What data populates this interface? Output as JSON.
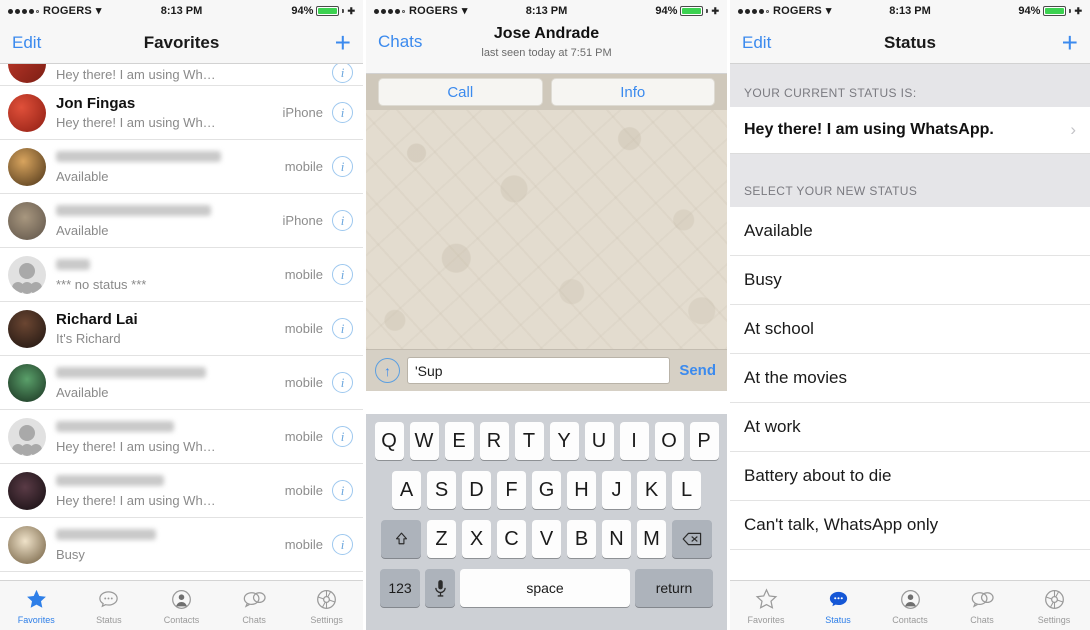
{
  "status_bar": {
    "carrier": "ROGERS",
    "wifi_icon": "wifi-icon",
    "time": "8:13 PM",
    "battery_pct": "94%"
  },
  "panel_favorites": {
    "nav": {
      "left_label": "Edit",
      "title": "Favorites",
      "right_icon": "plus-icon"
    },
    "rows": [
      {
        "name": "",
        "name_blurred": true,
        "sub": "Hey there! I am using Wh…",
        "label": "",
        "avatar": "photo",
        "partial": true
      },
      {
        "name": "Jon Fingas",
        "name_blurred": false,
        "sub": "Hey there! I am using Wh…",
        "label": "iPhone",
        "avatar": "photo"
      },
      {
        "name": "",
        "name_blurred": true,
        "sub": "Available",
        "label": "mobile",
        "avatar": "photo"
      },
      {
        "name": "",
        "name_blurred": true,
        "sub": "Available",
        "label": "iPhone",
        "avatar": "photo"
      },
      {
        "name": "",
        "name_blurred": true,
        "sub": "*** no status ***",
        "label": "mobile",
        "avatar": "placeholder"
      },
      {
        "name": "Richard Lai",
        "name_blurred": false,
        "sub": "It's Richard",
        "label": "mobile",
        "avatar": "photo"
      },
      {
        "name": "",
        "name_blurred": true,
        "sub": "Available",
        "label": "mobile",
        "avatar": "photo"
      },
      {
        "name": "",
        "name_blurred": true,
        "sub": "Hey there! I am using Wh…",
        "label": "mobile",
        "avatar": "placeholder"
      },
      {
        "name": "",
        "name_blurred": true,
        "sub": "Hey there! I am using Wh…",
        "label": "mobile",
        "avatar": "photo"
      },
      {
        "name": "",
        "name_blurred": true,
        "sub": "Busy",
        "label": "mobile",
        "avatar": "photo"
      }
    ]
  },
  "panel_chat": {
    "nav": {
      "back_label": "Chats",
      "title": "Jose Andrade",
      "subtitle": "last seen today at 7:51 PM"
    },
    "actions": [
      "Call",
      "Info"
    ],
    "input": {
      "attach_icon": "attach-up-arrow-icon",
      "value": "'Sup",
      "placeholder": "",
      "send_label": "Send"
    },
    "keyboard": {
      "row1": [
        "Q",
        "W",
        "E",
        "R",
        "T",
        "Y",
        "U",
        "I",
        "O",
        "P"
      ],
      "row2": [
        "A",
        "S",
        "D",
        "F",
        "G",
        "H",
        "J",
        "K",
        "L"
      ],
      "row3": [
        "Z",
        "X",
        "C",
        "V",
        "B",
        "N",
        "M"
      ],
      "shift_icon": "shift-icon",
      "backspace_icon": "backspace-icon",
      "numbers_label": "123",
      "mic_icon": "microphone-icon",
      "space_label": "space",
      "return_label": "return"
    }
  },
  "panel_status": {
    "nav": {
      "left_label": "Edit",
      "title": "Status",
      "right_icon": "plus-icon"
    },
    "current_header": "YOUR CURRENT STATUS IS:",
    "current_status": "Hey there! I am using WhatsApp.",
    "select_header": "SELECT YOUR NEW STATUS",
    "options": [
      "Available",
      "Busy",
      "At school",
      "At the movies",
      "At work",
      "Battery about to die",
      "Can't talk, WhatsApp only"
    ]
  },
  "tabs": [
    {
      "label": "Favorites",
      "icon": "star-icon"
    },
    {
      "label": "Status",
      "icon": "status-bubble-icon"
    },
    {
      "label": "Contacts",
      "icon": "contacts-person-icon"
    },
    {
      "label": "Chats",
      "icon": "chats-bubbles-icon"
    },
    {
      "label": "Settings",
      "icon": "settings-gear-icon"
    }
  ],
  "active_tab_favorites": "Favorites",
  "active_tab_status": "Status",
  "colors": {
    "accent": "#3b8aee",
    "battery_green": "#3cd251",
    "wallpaper": "#e3dccf"
  }
}
